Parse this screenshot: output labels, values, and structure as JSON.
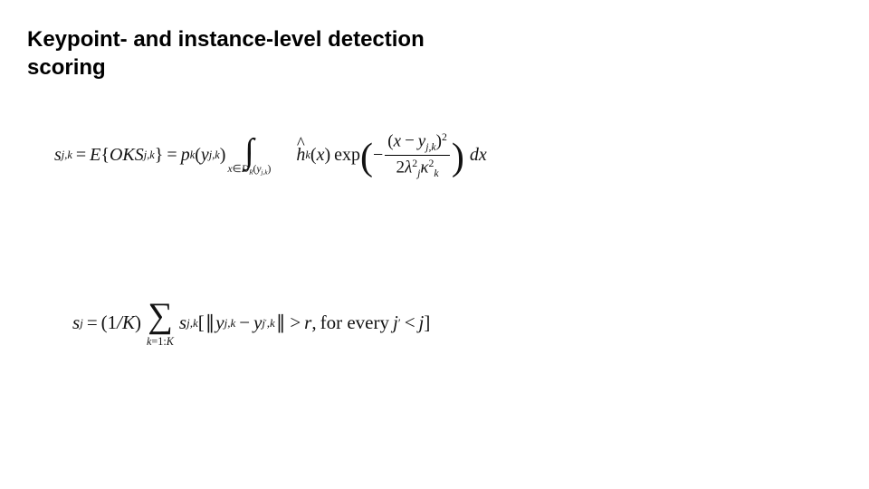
{
  "title": "Keypoint- and instance-level detection scoring",
  "eq1": {
    "lhs_var": "s",
    "lhs_sub": "j,k",
    "eq": "=",
    "E": "E",
    "lbr": "{",
    "OKS": "OKS",
    "OKS_sub": "j,k",
    "rbr": "}",
    "eq2": "=",
    "p": "p",
    "p_sub": "k",
    "p_arg_y": "y",
    "p_arg_sub": "j,k",
    "int_lower_x": "x",
    "int_lower_in": "∈",
    "int_lower_D": "D",
    "int_lower_Dsub": "R",
    "int_lower_y": "y",
    "int_lower_ysub": "j,k",
    "hhat": "h",
    "h_sub": "k",
    "h_arg": "x",
    "exp": "exp",
    "minus": "−",
    "num_l": "(",
    "num_x": "x",
    "num_minus": "−",
    "num_y": "y",
    "num_ysub": "j,k",
    "num_r": ")",
    "num_pow": "2",
    "den_two": "2",
    "den_lam": "λ",
    "den_lam_sup": "2",
    "den_lam_sub": "j",
    "den_kap": "κ",
    "den_kap_sup": "2",
    "den_kap_sub": "k",
    "dx_d": "d",
    "dx_x": "x"
  },
  "eq2": {
    "lhs_var": "s",
    "lhs_sub": "j",
    "eq": "=",
    "oneK_l": "(",
    "oneK_1": "1",
    "oneK_sl": "/",
    "oneK_K": "K",
    "oneK_r": ")",
    "sum_lower_k": "k",
    "sum_lower_eq": "=",
    "sum_lower_1": "1",
    "sum_lower_colon": ":",
    "sum_lower_K": "K",
    "s": "s",
    "s_sub": "j,k",
    "lbrk": "[",
    "norm": "∥",
    "y1": "y",
    "y1_sub": "j,k",
    "minus": "−",
    "y2": "y",
    "y2_sub_j": "j",
    "y2_sub_prime": "′",
    "y2_sub_k": ",k",
    "gt": ">",
    "r": "r",
    "comma": ",",
    "txt": "for every",
    "jprime_j": "j",
    "jprime_prime": "′",
    "lt": "<",
    "j": "j",
    "rbrk": "]"
  }
}
